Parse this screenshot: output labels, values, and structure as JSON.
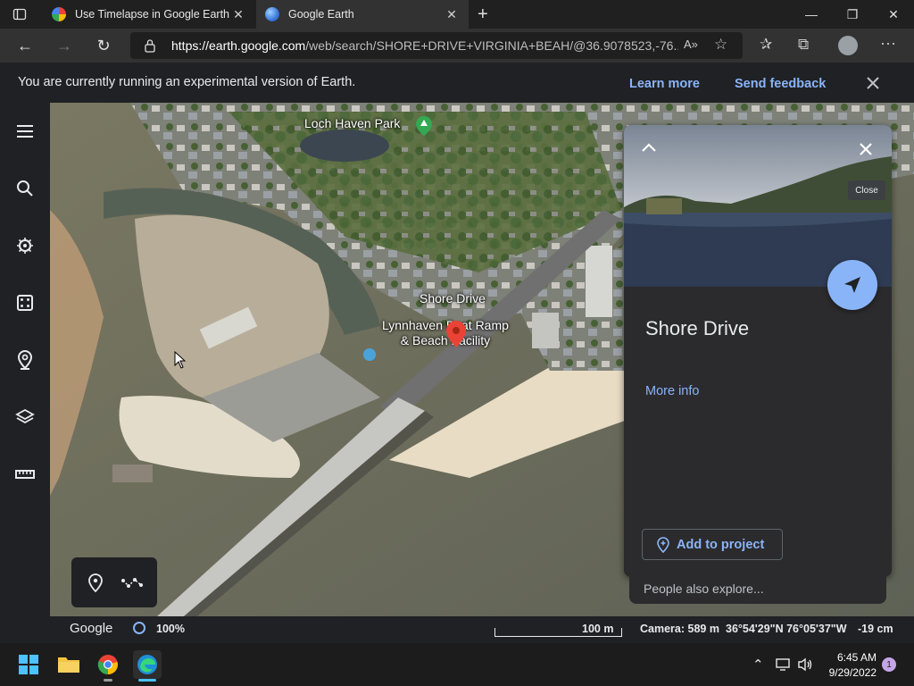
{
  "browser": {
    "tabs": [
      {
        "title": "Use Timelapse in Google Earth -",
        "active": false
      },
      {
        "title": "Google Earth",
        "active": true
      }
    ],
    "url_host": "https://earth.google.com",
    "url_path": "/web/search/SHORE+DRIVE+VIRGINIA+BEAH/@36.9078523,-76..."
  },
  "banner": {
    "text": "You are currently running an experimental version of Earth.",
    "learn_more": "Learn more",
    "send_feedback": "Send feedback"
  },
  "map": {
    "labels": {
      "park": "Loch Haven Park",
      "street": "Shore Drive",
      "facility_line1": "Lynnhaven Boat Ramp",
      "facility_line2": "& Beach Facility"
    }
  },
  "panel": {
    "title": "Shore Drive",
    "more_info": "More info",
    "add_to_project": "Add to project",
    "people_also_explore": "People also explore...",
    "close_tooltip": "Close"
  },
  "status": {
    "brand": "Google",
    "zoom": "100%",
    "scale": "100 m",
    "camera": "Camera: 589 m",
    "coords": "36°54'29\"N 76°05'37\"W",
    "elevation": "-19 cm"
  },
  "taskbar": {
    "time": "6:45 AM",
    "date": "9/29/2022",
    "notifications": "1"
  },
  "colors": {
    "accent": "#8ab4f8",
    "panel_bg": "#2b2b2d",
    "app_bg": "#202124"
  }
}
